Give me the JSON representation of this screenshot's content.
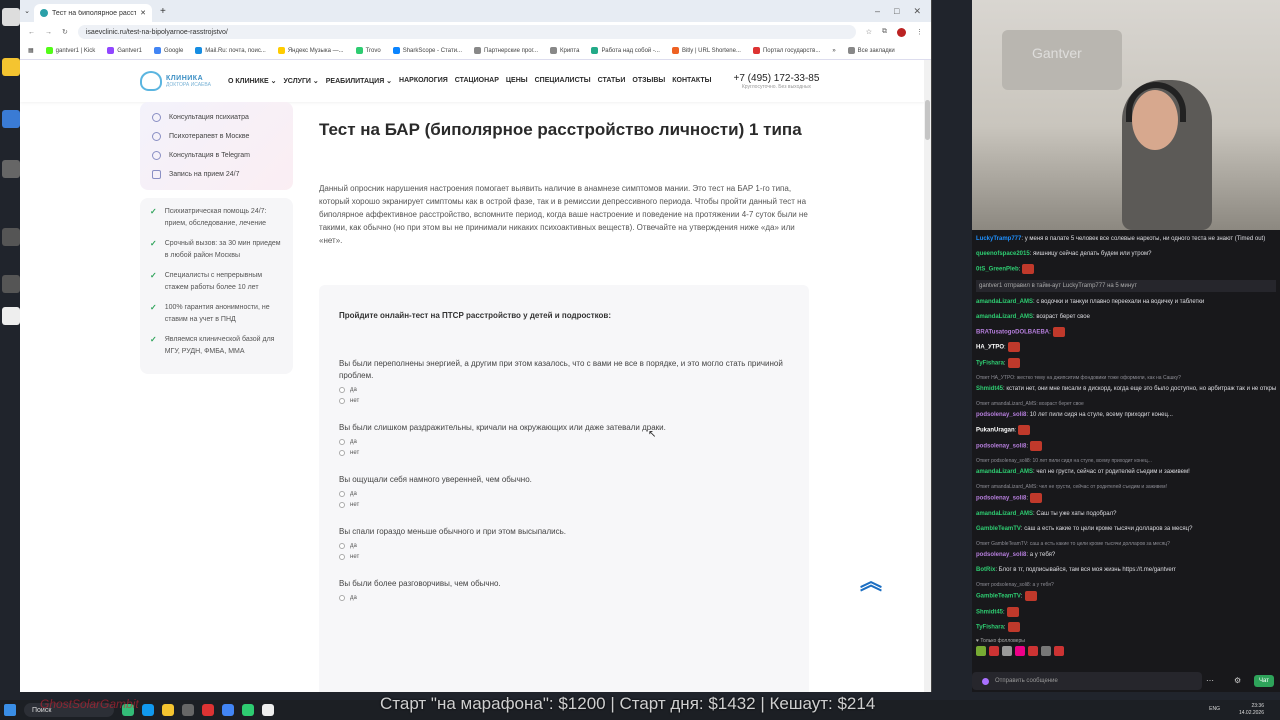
{
  "browser": {
    "tab_title": "Тест на биполярное расстро...",
    "url": "isaevclinic.ru/test-na-bipolyarnoe-rasstrojstvo/",
    "bookmarks": [
      "gantver1 | Kick",
      "Gantver1",
      "Google",
      "Mail.Ru: почта, поис...",
      "Яндекс Музыка —...",
      "Trovo",
      "SharkScope - Стати...",
      "Партнерские прог...",
      "Крипта",
      "Работа над собой -...",
      "Bitly | URL Shortene...",
      "Портал государств..."
    ],
    "all_bookmarks": "Все закладки"
  },
  "site": {
    "logo_line1": "КЛИНИКА",
    "logo_line2": "ДОКТОРА ИСАЕВА",
    "nav": [
      "О КЛИНИКЕ ⌄",
      "УСЛУГИ ⌄",
      "РЕАБИЛИТАЦИЯ ⌄",
      "НАРКОЛОГИЯ",
      "СТАЦИОНАР",
      "ЦЕНЫ",
      "СПЕЦИАЛИСТЫ",
      "СТАТЬИ",
      "ОТЗЫВЫ",
      "КОНТАКТЫ"
    ],
    "phone": "+7 (495) 172-33-85",
    "phone_sub": "Круглосуточно. Без выходных"
  },
  "sidebar": {
    "links": [
      "Консультация психиатра",
      "Психотерапевт в Москве",
      "Консультация в Telegram",
      "Запись на прием 24/7"
    ],
    "advantages": [
      "Психиатрическая помощь 24/7: прием, обследование, лечение",
      "Срочный вызов: за 30 мин приедем в любой район Москвы",
      "Специалисты с непрерывным стажем работы более 10 лет",
      "100% гарантия анонимности, не ставим на учет в ПНД",
      "Являемся клинической базой для МГУ, РУДН, ФМБА, ММА"
    ]
  },
  "main": {
    "title": "Тест на БАР (биполярное расстройство личности) 1 типа",
    "intro": "Данный опросник нарушения настроения помогает выявить наличие в анамнезе симптомов мании. Это тест на БАР 1-го типа, который хорошо экранирует симптомы как в острой фазе, так и в ремиссии депрессивного периода. Чтобы пройти данный тест на биполярное аффективное расстройство, вспомните период, когда ваше настроение и поведение на протяжении 4-7 суток были не такими, как обычно (но при этом вы не принимали никаких психоактивных веществ). Отвечайте на утверждения ниже «да» или «нет».",
    "quiz_heading": "Пройдите онлайн-тест на ПТСР расстройство у детей и подростков:",
    "questions": [
      "Вы были переполнены энергией, а другим при этом казалось, что с вами не все в порядке, и это могло стать причиной проблем.",
      "Вы были слишком раздражительны, кричали на окружающих или даже затевали драки.",
      "Вы ощущали себя намного уверенней, чем обычно.",
      "Вы спали гораздо меньше обычного и при этом высыпались.",
      "Вы были более разговорчивы, чем обычно."
    ],
    "opt_yes": "да",
    "opt_no": "нет"
  },
  "chat": {
    "messages": [
      {
        "user": "LuckyTramp777",
        "color": "#1e90ff",
        "text": ": у меня в палате 5 человек все солевые наркоты, ни одного теста не знают (Timed out)"
      },
      {
        "user": "queenofspace2015",
        "color": "#2ecc71",
        "text": ": яишницу сейчас делать будем или утром?"
      },
      {
        "user": "0tS_GreenPleb",
        "color": "#2ecc71",
        "text": ":",
        "emote": true
      },
      {
        "sys": true,
        "text": "gantver1 отправил в тайм-аут LuckyTramp777 на 5 минут"
      },
      {
        "user": "amandaLizard_AMS",
        "color": "#2ecc71",
        "text": ": с водочки и танкуи плавно переехали на водичку и таблетки"
      },
      {
        "user": "amandaLizard_AMS",
        "color": "#2ecc71",
        "text": ": возраст берет свое"
      },
      {
        "user": "BRATusatogoDOLBAEBA",
        "color": "#b57edc",
        "text": ":",
        "emote": true
      },
      {
        "user": "HA_УТРО",
        "color": "#ffffff",
        "text": ":",
        "emote": true
      },
      {
        "user": "TyFishara",
        "color": "#2ecc71",
        "text": ":",
        "emote": true
      },
      {
        "reply": true,
        "text": "Ответ HA_УТРО: жестко тему на джипситим фондовики тоже оформили, как на Сашку?"
      },
      {
        "user": "Shmidt45",
        "color": "#2ecc71",
        "text": ": кстати нет, они мне писали в дискорд, когда еще это было доступно, но арбитраж так и не открыли"
      },
      {
        "reply": true,
        "text": "Ответ amandaLizard_AMS: возраст берет свое"
      },
      {
        "user": "podsolenay_soli8",
        "color": "#b57edc",
        "text": ": 10 лет пили сидя на стуле, всему приходит конец..."
      },
      {
        "user": "PukanUragan",
        "color": "#ffffff",
        "text": ":",
        "emote": true
      },
      {
        "user": "podsolenay_soli8",
        "color": "#b57edc",
        "text": ":",
        "emote": true
      },
      {
        "reply": true,
        "text": "Ответ podsolenay_soli8: 10 лет пили сидя на стуле, всему приходит конец..."
      },
      {
        "user": "amandaLizard_AMS",
        "color": "#2ecc71",
        "text": ": чел не грусти, сейчас от родителей съедим и заживем!"
      },
      {
        "reply": true,
        "text": "Ответ amandaLizard_AMS: чел не грусти, сейчас от родителей съедим и заживем!"
      },
      {
        "user": "podsolenay_soli8",
        "color": "#b57edc",
        "text": ":",
        "emote": true
      },
      {
        "user": "amandaLizard_AMS",
        "color": "#2ecc71",
        "text": ": Саш ты уже хаты подобрал?"
      },
      {
        "user": "GambleTeamTV",
        "color": "#2ecc71",
        "text": ": саш а есть какие то цели кроме тысячи долларов за месяц?"
      },
      {
        "reply": true,
        "text": "Ответ GambleTeamTV: саш а есть какие то цели кроме тысячи долларов за месяц?"
      },
      {
        "user": "podsolenay_soli8",
        "color": "#b57edc",
        "text": ": а у тебя?"
      },
      {
        "user": "BotRix",
        "color": "#2ecc71",
        "text": ": Блог в тг, подписывайся, там вся моя жизнь https://t.me/gantverr"
      },
      {
        "reply": true,
        "text": "Ответ podsolenay_soli8: а у тебя?"
      },
      {
        "user": "GambleTeamTV",
        "color": "#2ecc71",
        "text": ":",
        "emote": true
      },
      {
        "user": "Shmidt45",
        "color": "#2ecc71",
        "text": ":",
        "emote": true
      },
      {
        "user": "TyFishara",
        "color": "#2ecc71",
        "text": ":",
        "emote": true
      }
    ],
    "followers_label": "♥ Только фолловеры",
    "input_placeholder": "Отправить сообщение",
    "send_label": "Чат"
  },
  "taskbar": {
    "search": "Поиск",
    "time": "23:36",
    "date": "14.02.2026",
    "lang": "ENG"
  },
  "overlay": {
    "ticker": "Старт \"на марафона\": $1200 | Старт дня: $1432 | Кешаут: $214",
    "ticker_left": "GhostSolarGambit"
  },
  "webcam": {
    "neon": "Gantver"
  }
}
